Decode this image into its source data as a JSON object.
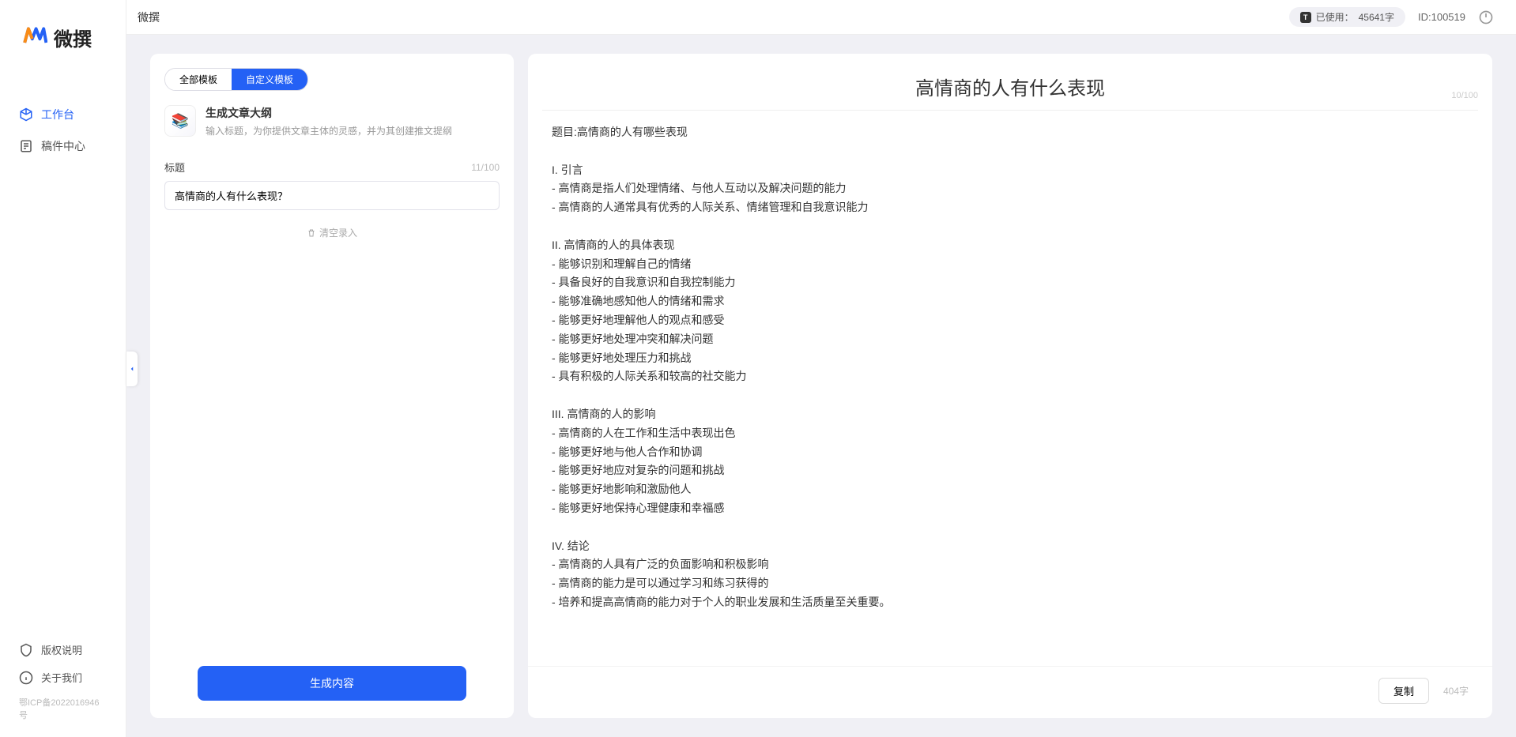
{
  "brand": {
    "name": "微撰"
  },
  "topbar": {
    "title": "微撰",
    "usage_label": "已使用：",
    "usage_value": "45641字",
    "user_id_label": "ID:",
    "user_id_value": "100519"
  },
  "sidebar": {
    "nav": [
      {
        "label": "工作台",
        "icon": "cube",
        "active": true
      },
      {
        "label": "稿件中心",
        "icon": "doc",
        "active": false
      }
    ],
    "bottom": [
      {
        "label": "版权说明",
        "icon": "shield"
      },
      {
        "label": "关于我们",
        "icon": "info"
      }
    ],
    "icp": "鄂ICP备2022016946号"
  },
  "left": {
    "tabs": [
      {
        "label": "全部模板",
        "active": false
      },
      {
        "label": "自定义模板",
        "active": true
      }
    ],
    "template": {
      "title": "生成文章大纲",
      "desc": "输入标题，为你提供文章主体的灵感，并为其创建推文提纲"
    },
    "field": {
      "label": "标题",
      "counter": "11/100",
      "value": "高情商的人有什么表现？"
    },
    "clear": "清空录入",
    "generate": "生成内容"
  },
  "right": {
    "title": "高情商的人有什么表现",
    "title_counter": "10/100",
    "body": "题目:高情商的人有哪些表现\n\nI. 引言\n- 高情商是指人们处理情绪、与他人互动以及解决问题的能力\n- 高情商的人通常具有优秀的人际关系、情绪管理和自我意识能力\n\nII. 高情商的人的具体表现\n- 能够识别和理解自己的情绪\n- 具备良好的自我意识和自我控制能力\n- 能够准确地感知他人的情绪和需求\n- 能够更好地理解他人的观点和感受\n- 能够更好地处理冲突和解决问题\n- 能够更好地处理压力和挑战\n- 具有积极的人际关系和较高的社交能力\n\nIII. 高情商的人的影响\n- 高情商的人在工作和生活中表现出色\n- 能够更好地与他人合作和协调\n- 能够更好地应对复杂的问题和挑战\n- 能够更好地影响和激励他人\n- 能够更好地保持心理健康和幸福感\n\nIV. 结论\n- 高情商的人具有广泛的负面影响和积极影响\n- 高情商的能力是可以通过学习和练习获得的\n- 培养和提高高情商的能力对于个人的职业发展和生活质量至关重要。",
    "copy": "复制",
    "word_count": "404字"
  }
}
